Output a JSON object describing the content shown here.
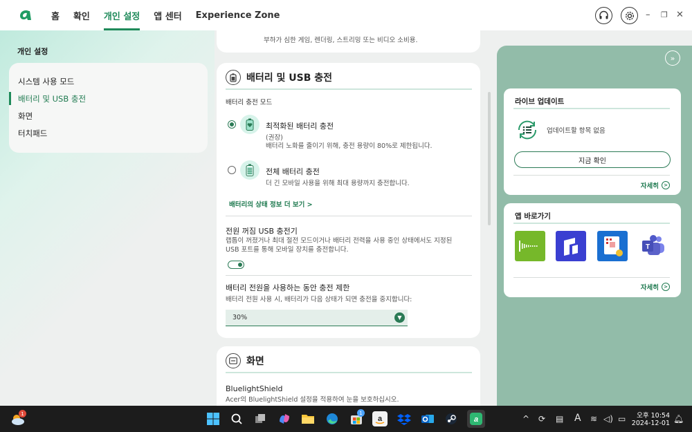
{
  "header": {
    "nav": [
      "홈",
      "확인",
      "개인 설정",
      "앱 센터",
      "Experience Zone"
    ],
    "active_nav": "개인 설정",
    "window_controls": [
      "–",
      "❐",
      "✕"
    ]
  },
  "left": {
    "title": "개인 설정",
    "items": [
      "시스템 사용 모드",
      "배터리 및 USB 충전",
      "화면",
      "터치패드"
    ]
  },
  "center": {
    "top_card_desc": "부하가 심한 게임, 렌더링, 스트리밍 또는 비디오 소비용.",
    "battery": {
      "title": "배터리 및 USB 충전",
      "charge_mode_label": "배터리 충전 모드",
      "opt1_title": "최적화된 배터리 충전",
      "opt1_rec": "(권장)",
      "opt1_desc": "배터리 노화를 줄이기 위해, 충전 용량이 80%로 제한됩니다.",
      "opt2_title": "전체 배터리 충전",
      "opt2_desc": "더 긴 모바일 사용을 위해 최대 용량까지 충전합니다.",
      "more_link": "배터리의 상태 정보 더 보기 >",
      "usb_title": "전원 꺼짐 USB 충전기",
      "usb_desc": "랩톱이 꺼졌거나 최대 절전 모드이거나 배터리 전력을 사용 중인 상태에서도 지정된 USB 포트를 통해 모바일 장치를 충전합니다.",
      "limit_title": "배터리 전원을 사용하는 동안 충전 제한",
      "limit_desc": "배터리 전원 사용 시, 배터리가 다음 상태가 되면 충전을 중지합니다:",
      "limit_value": "30%"
    },
    "screen": {
      "title": "화면",
      "bls_title": "BluelightShield",
      "bls_desc": "Acer의 BluelightShield 설정을 적용하여 눈을 보호하십시오."
    }
  },
  "right": {
    "live_update": {
      "title": "라이브 업데이트",
      "status": "업데이트할 항목 없음",
      "button": "지금 확인",
      "more": "자세히"
    },
    "shortcuts": {
      "title": "앱 바로가기",
      "more": "자세히",
      "apps": [
        "audio-app",
        "stack-app",
        "snip-app",
        "teams-app"
      ]
    }
  },
  "taskbar": {
    "weather_badge": "1",
    "store_badge": "1",
    "time": "오후 10:54",
    "date": "2024-12-01",
    "ime": "A"
  },
  "colors": {
    "accent": "#1f8a5a",
    "panel": "#92bca9",
    "taskbar": "#1c1c1c"
  }
}
